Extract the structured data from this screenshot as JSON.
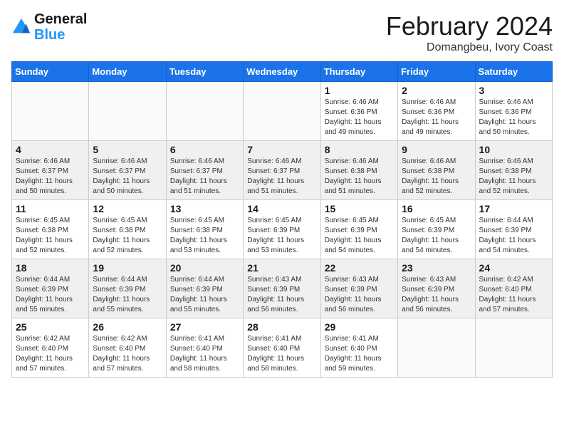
{
  "header": {
    "logo_line1": "General",
    "logo_line2": "Blue",
    "month": "February 2024",
    "location": "Domangbeu, Ivory Coast"
  },
  "weekdays": [
    "Sunday",
    "Monday",
    "Tuesday",
    "Wednesday",
    "Thursday",
    "Friday",
    "Saturday"
  ],
  "weeks": [
    [
      {
        "day": "",
        "info": ""
      },
      {
        "day": "",
        "info": ""
      },
      {
        "day": "",
        "info": ""
      },
      {
        "day": "",
        "info": ""
      },
      {
        "day": "1",
        "info": "Sunrise: 6:46 AM\nSunset: 6:36 PM\nDaylight: 11 hours\nand 49 minutes."
      },
      {
        "day": "2",
        "info": "Sunrise: 6:46 AM\nSunset: 6:36 PM\nDaylight: 11 hours\nand 49 minutes."
      },
      {
        "day": "3",
        "info": "Sunrise: 6:46 AM\nSunset: 6:36 PM\nDaylight: 11 hours\nand 50 minutes."
      }
    ],
    [
      {
        "day": "4",
        "info": "Sunrise: 6:46 AM\nSunset: 6:37 PM\nDaylight: 11 hours\nand 50 minutes."
      },
      {
        "day": "5",
        "info": "Sunrise: 6:46 AM\nSunset: 6:37 PM\nDaylight: 11 hours\nand 50 minutes."
      },
      {
        "day": "6",
        "info": "Sunrise: 6:46 AM\nSunset: 6:37 PM\nDaylight: 11 hours\nand 51 minutes."
      },
      {
        "day": "7",
        "info": "Sunrise: 6:46 AM\nSunset: 6:37 PM\nDaylight: 11 hours\nand 51 minutes."
      },
      {
        "day": "8",
        "info": "Sunrise: 6:46 AM\nSunset: 6:38 PM\nDaylight: 11 hours\nand 51 minutes."
      },
      {
        "day": "9",
        "info": "Sunrise: 6:46 AM\nSunset: 6:38 PM\nDaylight: 11 hours\nand 52 minutes."
      },
      {
        "day": "10",
        "info": "Sunrise: 6:46 AM\nSunset: 6:38 PM\nDaylight: 11 hours\nand 52 minutes."
      }
    ],
    [
      {
        "day": "11",
        "info": "Sunrise: 6:45 AM\nSunset: 6:38 PM\nDaylight: 11 hours\nand 52 minutes."
      },
      {
        "day": "12",
        "info": "Sunrise: 6:45 AM\nSunset: 6:38 PM\nDaylight: 11 hours\nand 52 minutes."
      },
      {
        "day": "13",
        "info": "Sunrise: 6:45 AM\nSunset: 6:38 PM\nDaylight: 11 hours\nand 53 minutes."
      },
      {
        "day": "14",
        "info": "Sunrise: 6:45 AM\nSunset: 6:39 PM\nDaylight: 11 hours\nand 53 minutes."
      },
      {
        "day": "15",
        "info": "Sunrise: 6:45 AM\nSunset: 6:39 PM\nDaylight: 11 hours\nand 54 minutes."
      },
      {
        "day": "16",
        "info": "Sunrise: 6:45 AM\nSunset: 6:39 PM\nDaylight: 11 hours\nand 54 minutes."
      },
      {
        "day": "17",
        "info": "Sunrise: 6:44 AM\nSunset: 6:39 PM\nDaylight: 11 hours\nand 54 minutes."
      }
    ],
    [
      {
        "day": "18",
        "info": "Sunrise: 6:44 AM\nSunset: 6:39 PM\nDaylight: 11 hours\nand 55 minutes."
      },
      {
        "day": "19",
        "info": "Sunrise: 6:44 AM\nSunset: 6:39 PM\nDaylight: 11 hours\nand 55 minutes."
      },
      {
        "day": "20",
        "info": "Sunrise: 6:44 AM\nSunset: 6:39 PM\nDaylight: 11 hours\nand 55 minutes."
      },
      {
        "day": "21",
        "info": "Sunrise: 6:43 AM\nSunset: 6:39 PM\nDaylight: 11 hours\nand 56 minutes."
      },
      {
        "day": "22",
        "info": "Sunrise: 6:43 AM\nSunset: 6:39 PM\nDaylight: 11 hours\nand 56 minutes."
      },
      {
        "day": "23",
        "info": "Sunrise: 6:43 AM\nSunset: 6:39 PM\nDaylight: 11 hours\nand 56 minutes."
      },
      {
        "day": "24",
        "info": "Sunrise: 6:42 AM\nSunset: 6:40 PM\nDaylight: 11 hours\nand 57 minutes."
      }
    ],
    [
      {
        "day": "25",
        "info": "Sunrise: 6:42 AM\nSunset: 6:40 PM\nDaylight: 11 hours\nand 57 minutes."
      },
      {
        "day": "26",
        "info": "Sunrise: 6:42 AM\nSunset: 6:40 PM\nDaylight: 11 hours\nand 57 minutes."
      },
      {
        "day": "27",
        "info": "Sunrise: 6:41 AM\nSunset: 6:40 PM\nDaylight: 11 hours\nand 58 minutes."
      },
      {
        "day": "28",
        "info": "Sunrise: 6:41 AM\nSunset: 6:40 PM\nDaylight: 11 hours\nand 58 minutes."
      },
      {
        "day": "29",
        "info": "Sunrise: 6:41 AM\nSunset: 6:40 PM\nDaylight: 11 hours\nand 59 minutes."
      },
      {
        "day": "",
        "info": ""
      },
      {
        "day": "",
        "info": ""
      }
    ]
  ]
}
